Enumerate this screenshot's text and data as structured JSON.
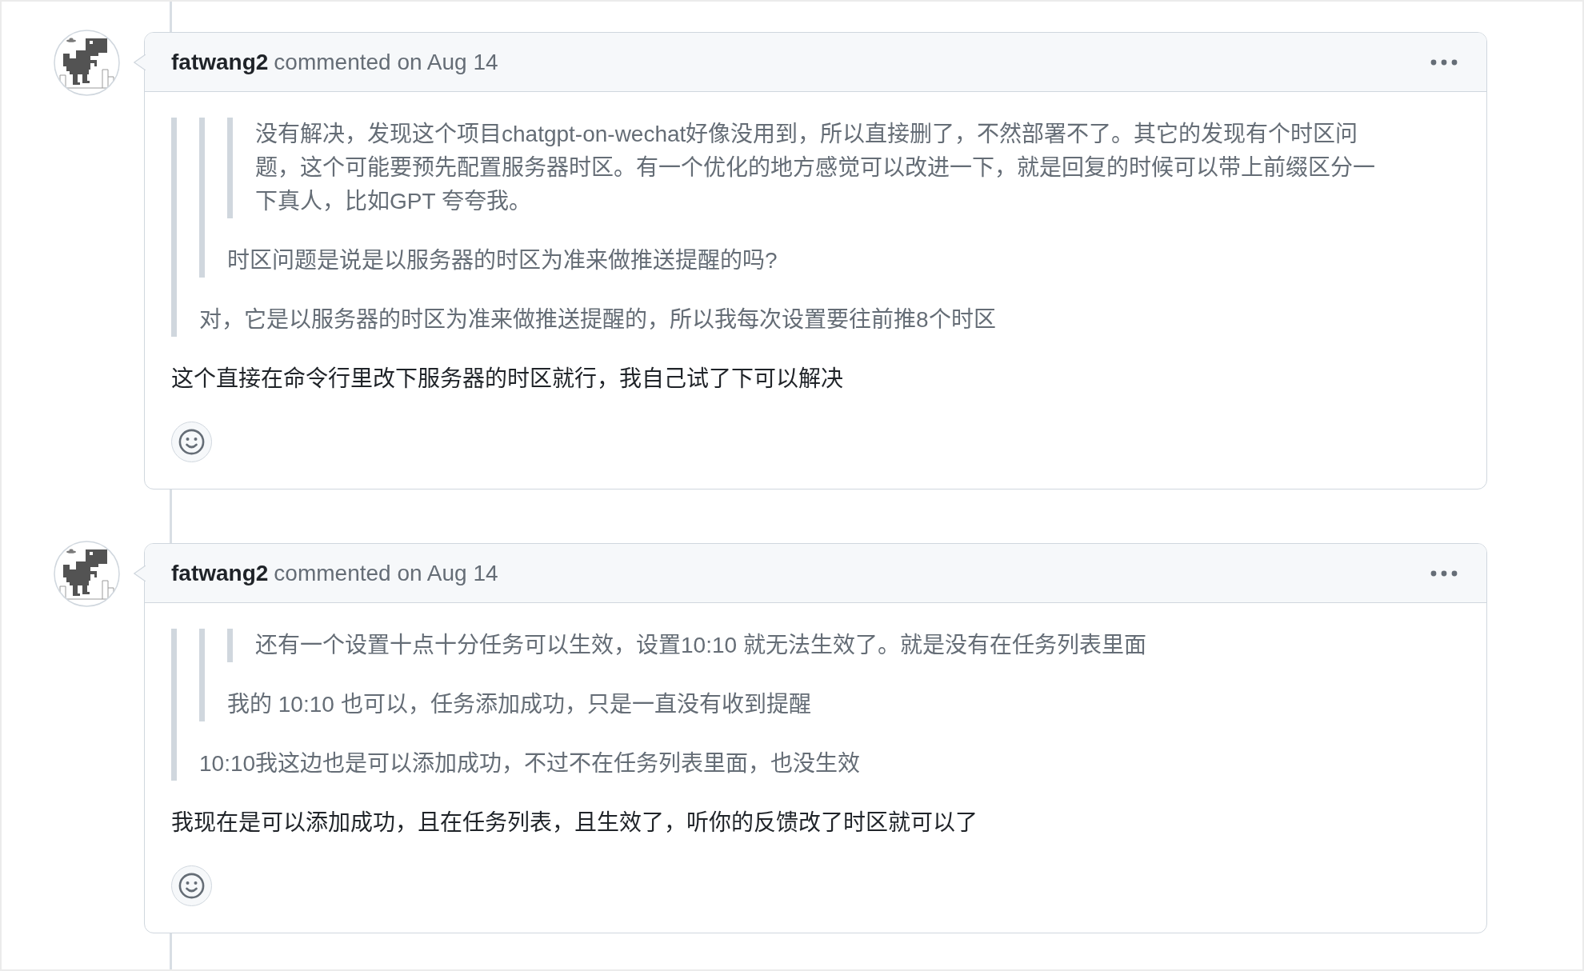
{
  "comments": [
    {
      "author": "fatwang2",
      "meta": "commented on Aug 14",
      "body": [
        {
          "kind": "quote",
          "children": [
            {
              "kind": "quote",
              "children": [
                {
                  "kind": "quote",
                  "children": [
                    {
                      "kind": "paragraph",
                      "text": "没有解决，发现这个项目chatgpt-on-wechat好像没用到，所以直接删了，不然部署不了。其它的发现有个时区问题，这个可能要预先配置服务器时区。有一个优化的地方感觉可以改进一下，就是回复的时候可以带上前缀区分一下真人，比如GPT 夸夸我。"
                    }
                  ]
                },
                {
                  "kind": "paragraph",
                  "text": "时区问题是说是以服务器的时区为准来做推送提醒的吗?"
                }
              ]
            },
            {
              "kind": "paragraph",
              "text": "对，它是以服务器的时区为准来做推送提醒的，所以我每次设置要往前推8个时区"
            }
          ]
        },
        {
          "kind": "paragraph",
          "text": "这个直接在命令行里改下服务器的时区就行，我自己试了下可以解决"
        }
      ]
    },
    {
      "author": "fatwang2",
      "meta": "commented on Aug 14",
      "body": [
        {
          "kind": "quote",
          "children": [
            {
              "kind": "quote",
              "children": [
                {
                  "kind": "quote",
                  "children": [
                    {
                      "kind": "paragraph",
                      "text": "还有一个设置十点十分任务可以生效，设置10:10 就无法生效了。就是没有在任务列表里面"
                    }
                  ]
                },
                {
                  "kind": "paragraph",
                  "text": "我的 10:10 也可以，任务添加成功，只是一直没有收到提醒"
                }
              ]
            },
            {
              "kind": "paragraph",
              "text": "10:10我这边也是可以添加成功，不过不在任务列表里面，也没生效"
            }
          ]
        },
        {
          "kind": "paragraph",
          "text": "我现在是可以添加成功，且在任务列表，且生效了，听你的反馈改了时区就可以了"
        }
      ]
    }
  ]
}
